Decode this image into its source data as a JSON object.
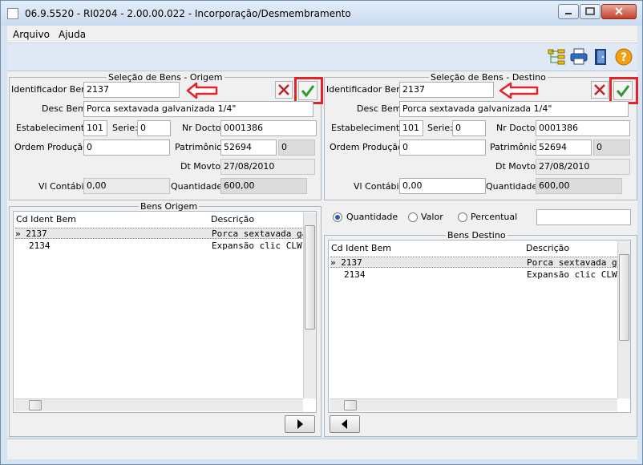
{
  "window": {
    "title": "06.9.5520 - RI0204 - 2.00.00.022 - Incorporação/Desmembramento"
  },
  "menu": {
    "arquivo": "Arquivo",
    "ajuda": "Ajuda"
  },
  "toolbar": {
    "icons": [
      "tree-icon",
      "printer-icon",
      "exit-door-icon",
      "help-icon"
    ]
  },
  "origem": {
    "group_title": "Seleção de Bens - Origem",
    "identificador_label": "Identificador Bem:",
    "identificador_value": "2137",
    "desc_label": "Desc Bem:",
    "desc_value": "Porca sextavada galvanizada 1/4\"",
    "estab_label": "Estabelecimento:",
    "estab_value": "101",
    "serie_label": "Serie:",
    "serie_value": "0",
    "nrdocto_label": "Nr Docto:",
    "nrdocto_value": "0001386",
    "ordem_label": "Ordem Produção:",
    "ordem_value": "0",
    "patrimonio_label": "Patrimônio:",
    "patrimonio_value": "52694",
    "patrimonio_seq": "0",
    "dtmovto_label": "Dt Movto:",
    "dtmovto_value": "27/08/2010",
    "vlcontabil_label": "Vl Contábil:",
    "vlcontabil_value": "0,00",
    "quantidade_label": "Quantidade:",
    "quantidade_value": "600,00"
  },
  "destino": {
    "group_title": "Seleção de Bens - Destino",
    "identificador_label": "Identificador Bem:",
    "identificador_value": "2137",
    "desc_label": "Desc Bem:",
    "desc_value": "Porca sextavada galvanizada 1/4\"",
    "estab_label": "Estabelecimento:",
    "estab_value": "101",
    "serie_label": "Serie:",
    "serie_value": "0",
    "nrdocto_label": "Nr Docto:",
    "nrdocto_value": "0001386",
    "ordem_label": "Ordem Produção:",
    "ordem_value": "0",
    "patrimonio_label": "Patrimônio:",
    "patrimonio_value": "52694",
    "patrimonio_seq": "0",
    "dtmovto_label": "Dt Movto:",
    "dtmovto_value": "27/08/2010",
    "vlcontabil_label": "Vl Contábil:",
    "vlcontabil_value": "0,00",
    "quantidade_label": "Quantidade:",
    "quantidade_value": "600,00"
  },
  "bens_origem": {
    "title": "Bens Origem",
    "col_cd": "Cd Ident Bem",
    "col_desc": "Descrição",
    "rows": [
      {
        "marker": "»",
        "cd": "2137",
        "desc": "Porca sextavada ga"
      },
      {
        "marker": "",
        "cd": "2134",
        "desc": "Expansão clic CLW-"
      }
    ]
  },
  "rateio": {
    "quantidade": "Quantidade",
    "valor": "Valor",
    "percentual": "Percentual",
    "selected": "quantidade"
  },
  "bens_destino": {
    "title": "Bens Destino",
    "col_cd": "Cd Ident Bem",
    "col_desc": "Descrição",
    "rows": [
      {
        "marker": "»",
        "cd": "2137",
        "desc": "Porca sextavada ga"
      },
      {
        "marker": "",
        "cd": "2134",
        "desc": "Expansão clic CLW-"
      }
    ]
  },
  "colors": {
    "highlight": "#e0242a",
    "confirm_green": "#2e9a2e",
    "cancel_red": "#c0202a"
  }
}
